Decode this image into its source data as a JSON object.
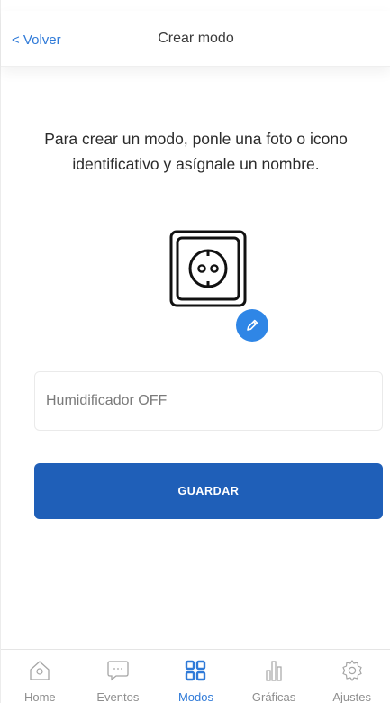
{
  "header": {
    "back_label": "< Volver",
    "title": "Crear modo"
  },
  "main": {
    "intro_text": "Para crear un modo, ponle una foto o icono identificativo y asígnale un nombre.",
    "mode_icon": "power-socket-icon",
    "edit_icon": "pencil-icon",
    "name_field": {
      "value": "",
      "placeholder": "Humidificador OFF"
    },
    "save_label": "GUARDAR"
  },
  "tabbar": {
    "items": [
      {
        "label": "Home",
        "icon": "home-icon",
        "active": false
      },
      {
        "label": "Eventos",
        "icon": "chat-bubble-icon",
        "active": false
      },
      {
        "label": "Modos",
        "icon": "grid-icon",
        "active": true
      },
      {
        "label": "Gráficas",
        "icon": "bar-chart-icon",
        "active": false
      },
      {
        "label": "Ajustes",
        "icon": "gear-icon",
        "active": false
      }
    ]
  },
  "colors": {
    "accent": "#2f7ad8",
    "button": "#1f5fb8",
    "edit_badge": "#2f86e6"
  }
}
